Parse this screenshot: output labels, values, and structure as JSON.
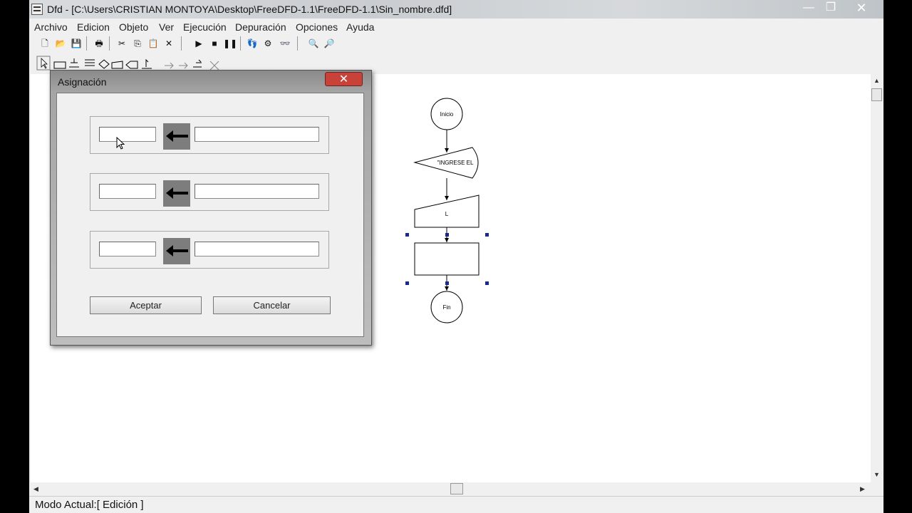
{
  "window": {
    "title": "Dfd - [C:\\Users\\CRISTIAN  MONTOYA\\Desktop\\FreeDFD-1.1\\FreeDFD-1.1\\Sin_nombre.dfd]",
    "minimize": "—",
    "maximize": "❐",
    "close": "✕"
  },
  "menu": [
    "Archivo",
    "Edicion",
    "Objeto",
    "Ver",
    "Ejecución",
    "Depuración",
    "Opciones",
    "Ayuda"
  ],
  "toolbar": {
    "new": "🗋",
    "open": "📂",
    "save": "💾",
    "print": "🖶",
    "cut": "✂",
    "copy": "⎘",
    "paste": "📋",
    "delete": "✕",
    "run": "▶",
    "stop": "■",
    "pause": "❚❚",
    "step": "👣",
    "debug": "⚙",
    "watch": "👓",
    "zoom_out": "🔍",
    "zoom_in": "🔎"
  },
  "dialog": {
    "title": "Asignación",
    "close": "✕",
    "accept": "Aceptar",
    "cancel": "Cancelar",
    "rows": [
      {
        "variable": "",
        "expression": ""
      },
      {
        "variable": "",
        "expression": ""
      },
      {
        "variable": "",
        "expression": ""
      }
    ]
  },
  "flowchart": {
    "start": "Inicio",
    "output": "\"INGRESE EL",
    "input": "L",
    "end": "Fin"
  },
  "status": "Modo Actual:[ Edición ]"
}
